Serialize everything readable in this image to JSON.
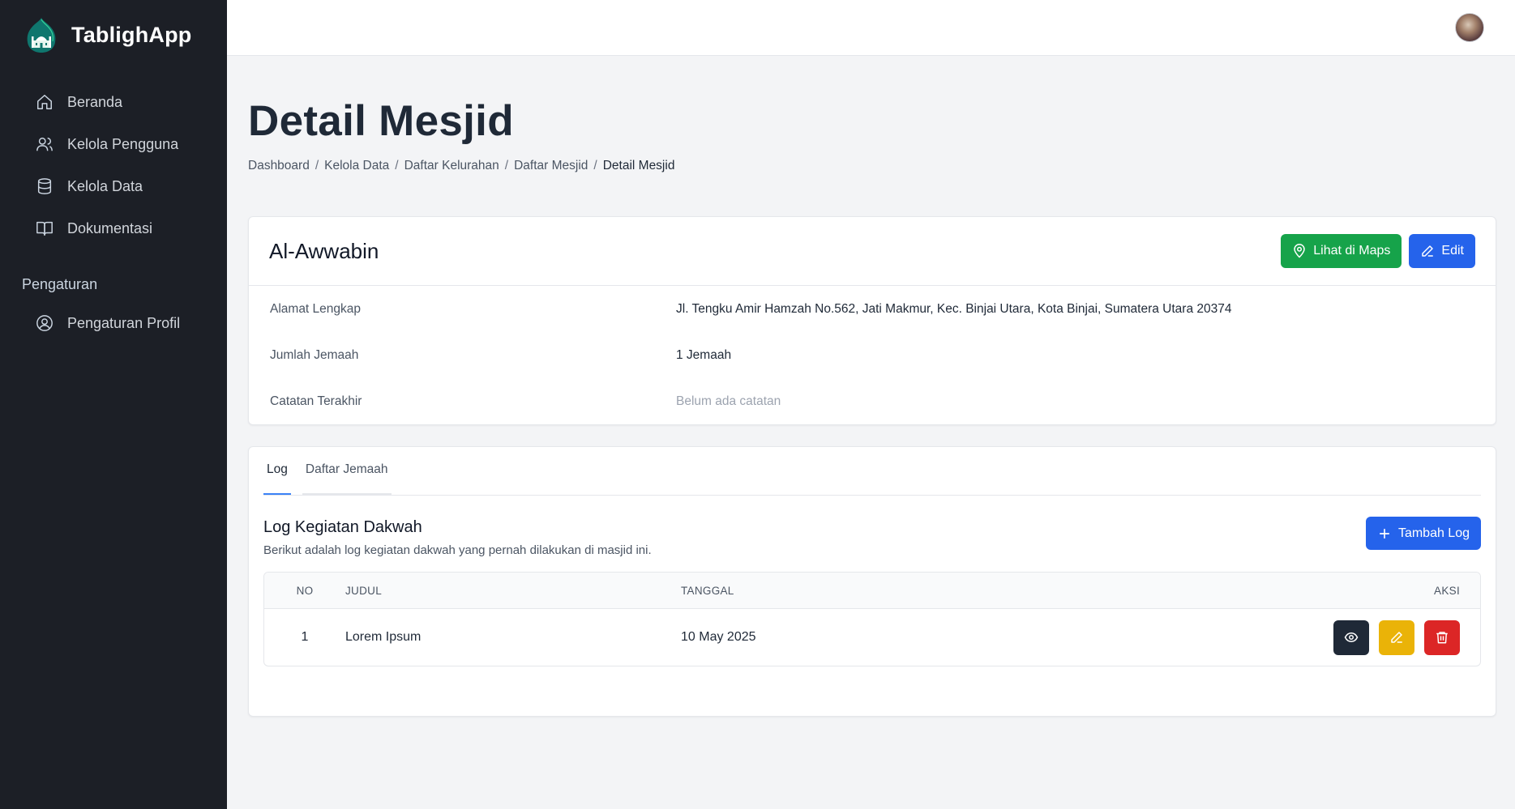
{
  "app": {
    "name": "TablighApp"
  },
  "sidebar": {
    "items": [
      {
        "label": "Beranda",
        "icon": "home-icon"
      },
      {
        "label": "Kelola Pengguna",
        "icon": "users-icon"
      },
      {
        "label": "Kelola Data",
        "icon": "database-icon"
      },
      {
        "label": "Dokumentasi",
        "icon": "book-icon"
      }
    ],
    "section_label": "Pengaturan",
    "settings_items": [
      {
        "label": "Pengaturan Profil",
        "icon": "user-circle-icon"
      }
    ]
  },
  "page": {
    "title": "Detail Mesjid",
    "breadcrumb": [
      "Dashboard",
      "Kelola Data",
      "Daftar Kelurahan",
      "Daftar Mesjid",
      "Detail Mesjid"
    ]
  },
  "mosque": {
    "name": "Al-Awwabin",
    "maps_button": "Lihat di Maps",
    "edit_button": "Edit",
    "details": [
      {
        "label": "Alamat Lengkap",
        "value": "Jl. Tengku Amir Hamzah No.562, Jati Makmur, Kec. Binjai Utara, Kota Binjai, Sumatera Utara 20374"
      },
      {
        "label": "Jumlah Jemaah",
        "value": "1 Jemaah"
      },
      {
        "label": "Catatan Terakhir",
        "value": "Belum ada catatan"
      }
    ]
  },
  "tabs": [
    {
      "label": "Log",
      "active": true
    },
    {
      "label": "Daftar Jemaah",
      "active": false
    }
  ],
  "log": {
    "title": "Log Kegiatan Dakwah",
    "description": "Berikut adalah log kegiatan dakwah yang pernah dilakukan di masjid ini.",
    "add_button": "Tambah Log",
    "columns": [
      "NO",
      "JUDUL",
      "TANGGAL",
      "AKSI"
    ],
    "rows": [
      {
        "no": "1",
        "judul": "Lorem Ipsum",
        "tanggal": "10 May 2025"
      }
    ]
  },
  "colors": {
    "sidebar_bg": "#1c1f26",
    "green": "#16a34a",
    "blue": "#2563eb",
    "yellow": "#eab308",
    "red": "#dc2626",
    "dark": "#1f2937"
  }
}
